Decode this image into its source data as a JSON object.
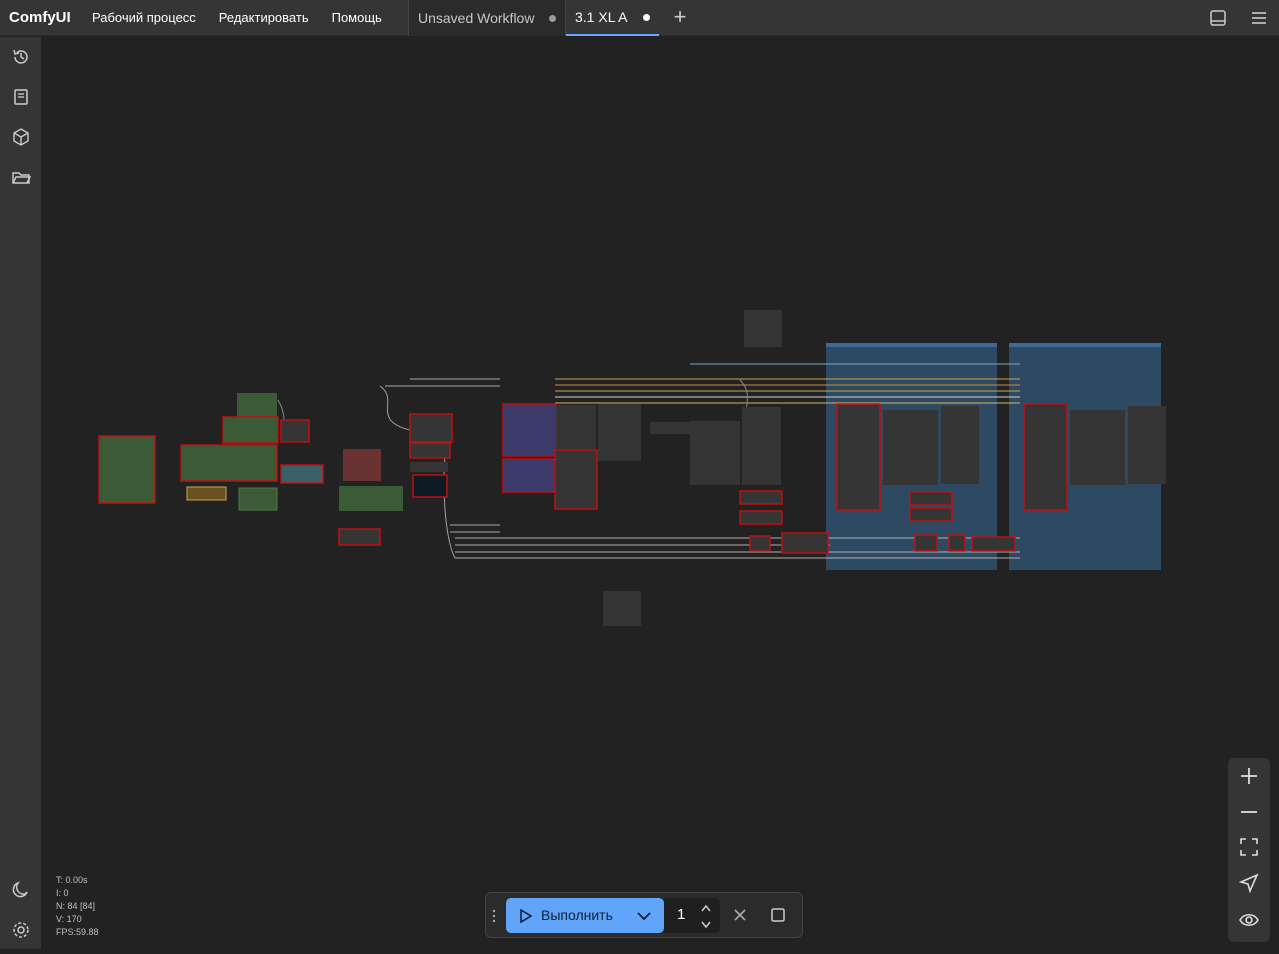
{
  "app": {
    "brand": "ComfyUI",
    "menu": [
      "Рабочий процесс",
      "Редактировать",
      "Помощь"
    ]
  },
  "tabs": [
    {
      "label": "Unsaved Workflow",
      "active": false
    },
    {
      "label": "3.1 XL A",
      "active": true
    }
  ],
  "stats": {
    "t": "T: 0.00s",
    "i": "I: 0",
    "n": "N: 84 [84]",
    "v": "V: 170",
    "fps": "FPS:59.88"
  },
  "runbar": {
    "run_label": "Выполнить",
    "count": "1"
  },
  "colors": {
    "accent": "#60a5fa",
    "node_error": "#c01010",
    "group_blue": "#2e4a63",
    "node_green": "#3a5b35",
    "node_purple": "#3b3a6a",
    "node_red": "#6a3333"
  },
  "icons": {
    "sidebar": [
      "history-icon",
      "library-icon",
      "model-cube-icon",
      "folder-icon",
      "theme-moon-icon",
      "settings-gear-icon"
    ],
    "zoom": [
      "zoom-in-icon",
      "zoom-out-icon",
      "fit-view-icon",
      "locate-icon",
      "visibility-icon"
    ]
  }
}
